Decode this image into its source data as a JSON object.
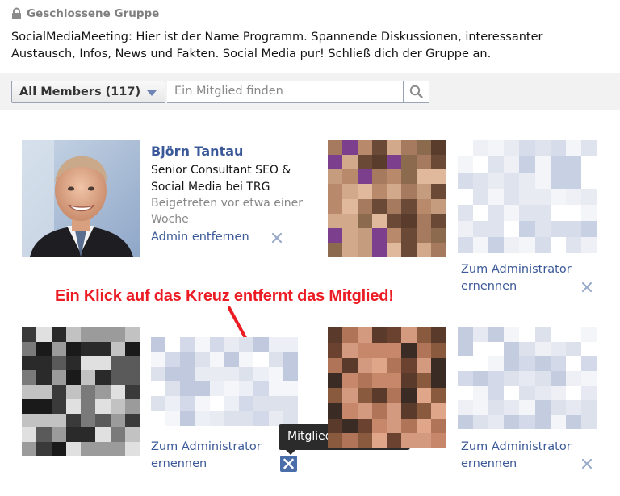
{
  "group": {
    "type_label": "Geschlossene Gruppe",
    "description": "SocialMediaMeeting: Hier ist der Name Programm. Spannende Diskussionen, interessanter Austausch, Infos, News und Fakten. Social Media pur! Schließ dich der Gruppe an."
  },
  "filter": {
    "members_label": "All Members (117)",
    "search_placeholder": "Ein Mitglied finden"
  },
  "members": [
    {
      "name": "Björn Tantau",
      "title": "Senior Consultant SEO & Social Media bei TRG",
      "joined": "Beigetreten vor etwa einer Woche",
      "action": "Admin entfernen"
    },
    {
      "action": "Zum Administrator ernennen"
    },
    {
      "action": "Zum Administrator ernennen"
    },
    {
      "action": "Zum Administrator ernennen"
    }
  ],
  "annotation": "Ein Klick auf das Kreuz entfernt das Mitglied!",
  "tooltip": "Mitglied entfernen",
  "colors": {
    "link": "#3b5998",
    "annotation": "#ec1c24",
    "tooltip_bg": "#2b2b2b",
    "x_active_bg": "#4a6ea9"
  },
  "icons": [
    "lock-icon",
    "chevron-down-icon",
    "search-icon",
    "close-icon"
  ]
}
